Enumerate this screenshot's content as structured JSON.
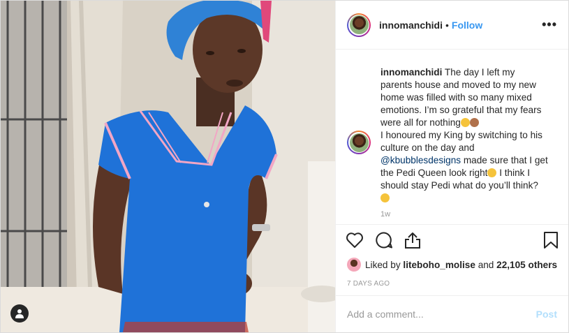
{
  "header": {
    "username": "innomanchidi",
    "separator": "•",
    "follow_label": "Follow",
    "more_label": "•••"
  },
  "caption": {
    "username": "innomanchidi",
    "text_part1": "The day I left my parents house and moved to my new home was filled with so many mixed emotions. I’m so grateful that my fears were all for nothing",
    "text_part2": "I honoured my King by switching to his culture on the day and",
    "mention": "@kbubblesdesigns",
    "text_part3": "made sure that I get the Pedi Queen look right",
    "text_part4": "I think I should stay Pedi what do you’ll think?",
    "time_ago": "1w"
  },
  "likes": {
    "prefix": "Liked by",
    "user": "liteboho_molise",
    "middle": "and",
    "count": "22,105 others"
  },
  "date": "7 DAYS AGO",
  "comment_box": {
    "placeholder": "Add a comment...",
    "post_label": "Post"
  },
  "colors": {
    "accent": "#3897f0",
    "post_disabled": "#b2dffc",
    "dress": "#1f72d8",
    "headwrap": "#2f82d6"
  },
  "icons": [
    "heart-icon",
    "comment-icon",
    "share-icon",
    "bookmark-icon",
    "user-tag-icon",
    "more-icon"
  ]
}
